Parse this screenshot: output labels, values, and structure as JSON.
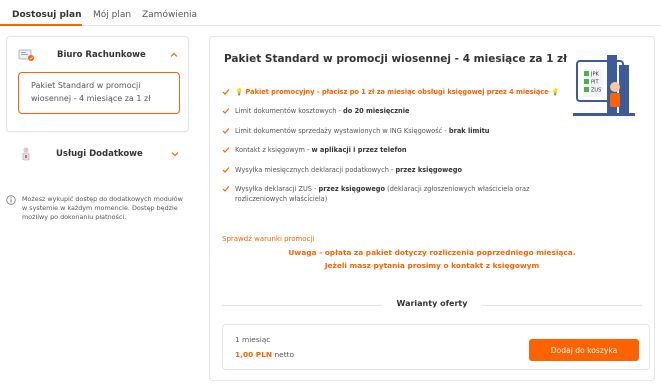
{
  "tabs": [
    {
      "label": "Dostosuj plan",
      "active": true
    },
    {
      "label": "Mój plan",
      "active": false
    },
    {
      "label": "Zamówienia",
      "active": false
    }
  ],
  "sidebar": {
    "section_1": {
      "label": "Biuro Rachunkowe",
      "expanded": true,
      "icon": "accountant-office-icon"
    },
    "selected_plan": {
      "line1": "Pakiet Standard w promocji",
      "line2": "wiosennej - 4 miesiące za 1 zł"
    },
    "section_2": {
      "label": "Usługi Dodatkowe",
      "expanded": false,
      "icon": "additional-services-icon"
    },
    "info": "Możesz wykupić dostęp do dodatkowych modułów w systemie w każdym momencie. Dostęp będzie możliwy po dokonaniu płatności."
  },
  "main": {
    "title": "Pakiet Standard w promocji wiosennej - 4 miesiące za 1 zł",
    "features": [
      {
        "pre": "💡 Pakiet promocyjny - płacisz po 1 zł za miesiąc obsługi księgowej przez 4 miesiące 💡",
        "bold": "",
        "post": "",
        "promo": true
      },
      {
        "pre": "Limit dokumentów kosztowych - ",
        "bold": "do 20 miesięcznie",
        "post": ""
      },
      {
        "pre": "Limit dokumentów sprzedaży wystawionych w ING Księgowość - ",
        "bold": "brak limitu",
        "post": ""
      },
      {
        "pre": "Kontakt z księgowym - ",
        "bold": "w aplikacji i przez telefon",
        "post": ""
      },
      {
        "pre": "Wysyłka miesięcznych deklaracji podatkowych - ",
        "bold": "przez księgowego",
        "post": ""
      },
      {
        "pre": "Wysyłka deklaracji ZUS - ",
        "bold": "przez księgowego",
        "post": " (deklaracji zgłoszeniowych właściciela oraz rozliczeniowych właściciela)"
      }
    ],
    "illustration": {
      "labels": [
        "JPK",
        "PIT",
        "ZUS"
      ]
    },
    "terms_link": "Sprawdź warunki promocji",
    "warning_1": "Uwaga - opłata za pakiet dotyczy rozliczenia poprzedniego miesiąca.",
    "warning_2": "Jeżeli masz pytania prosimy o kontakt z księgowym",
    "variants_label": "Warianty oferty",
    "offer": {
      "period": "1 miesiąc",
      "amount": "1,00 PLN",
      "net": "netto",
      "button": "Dodaj do koszyka"
    }
  },
  "colors": {
    "accent": "#ff6200",
    "border": "#e4e4e4",
    "text": "#333333"
  }
}
